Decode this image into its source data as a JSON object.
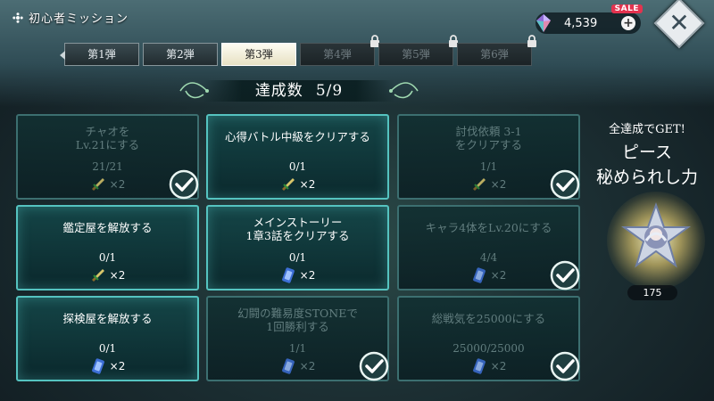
{
  "header": {
    "title": "初心者ミッション",
    "title_icon": "gear-flower-icon"
  },
  "currency": {
    "amount": "4,539",
    "sale_badge": "SALE",
    "plus_label": "+",
    "icon": "gem-icon"
  },
  "close_label": "✕",
  "tabs": [
    {
      "label": "第1弾",
      "state": "normal"
    },
    {
      "label": "第2弾",
      "state": "normal"
    },
    {
      "label": "第3弾",
      "state": "active"
    },
    {
      "label": "第4弾",
      "state": "locked"
    },
    {
      "label": "第5弾",
      "state": "locked"
    },
    {
      "label": "第6弾",
      "state": "locked"
    }
  ],
  "progress": {
    "label": "達成数",
    "value": "5/9"
  },
  "missions": [
    {
      "name": "チャオを\nLv.21にする",
      "progress": "21/21",
      "reward_icon": "sword-icon",
      "reward_count": "×2",
      "done": true
    },
    {
      "name": "心得バトル中級をクリアする",
      "progress": "0/1",
      "reward_icon": "sword-icon",
      "reward_count": "×2",
      "done": false
    },
    {
      "name": "討伐依頼 3-1\nをクリアする",
      "progress": "1/1",
      "reward_icon": "sword-icon",
      "reward_count": "×2",
      "done": true
    },
    {
      "name": "鑑定屋を解放する",
      "progress": "0/1",
      "reward_icon": "sword-icon",
      "reward_count": "×2",
      "done": false
    },
    {
      "name": "メインストーリー\n1章3話をクリアする",
      "progress": "0/1",
      "reward_icon": "ticket-icon",
      "reward_count": "×2",
      "done": false
    },
    {
      "name": "キャラ4体をLv.20にする",
      "progress": "4/4",
      "reward_icon": "ticket-icon",
      "reward_count": "×2",
      "done": true
    },
    {
      "name": "探検屋を解放する",
      "progress": "0/1",
      "reward_icon": "ticket-icon",
      "reward_count": "×2",
      "done": false
    },
    {
      "name": "幻闘の難易度STONEで\n1回勝利する",
      "progress": "1/1",
      "reward_icon": "ticket-icon",
      "reward_count": "×2",
      "done": true
    },
    {
      "name": "総戦気を25000にする",
      "progress": "25000/25000",
      "reward_icon": "ticket-icon",
      "reward_count": "×2",
      "done": true
    }
  ],
  "completion_reward": {
    "line1": "全達成でGET!",
    "line2": "ピース",
    "line3": "秘められし力",
    "count": "175",
    "icon": "star-character-icon"
  }
}
